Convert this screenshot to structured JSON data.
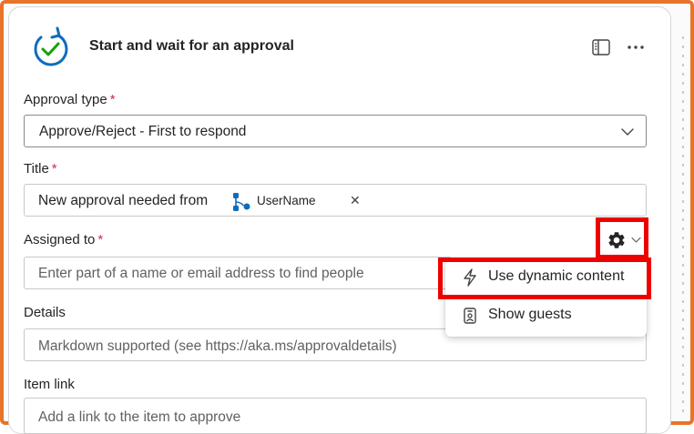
{
  "action": {
    "title": "Start and wait for an approval",
    "icon": "approval-refresh-check-icon"
  },
  "header_actions": [
    {
      "name": "panel",
      "icon": "side-panel-icon"
    },
    {
      "name": "more",
      "icon": "more-horizontal-icon"
    }
  ],
  "fields": {
    "approval_type": {
      "label": "Approval type",
      "required_marker": "*",
      "value": "Approve/Reject - First to respond"
    },
    "title": {
      "label": "Title",
      "required_marker": "*",
      "value_prefix": "New approval needed from",
      "token_label": "UserName",
      "token_remove": "✕"
    },
    "assigned_to": {
      "label": "Assigned to",
      "required_marker": "*",
      "placeholder": "Enter part of a name or email address to find people"
    },
    "details": {
      "label": "Details",
      "placeholder": "Markdown supported (see https://aka.ms/approvaldetails)"
    },
    "item_link": {
      "label": "Item link",
      "placeholder": "Add a link to the item to approve"
    }
  },
  "settings_menu": {
    "items": [
      {
        "label": "Use dynamic content",
        "icon": "lightning-icon"
      },
      {
        "label": "Show guests",
        "icon": "guest-badge-icon"
      }
    ]
  },
  "colors": {
    "frame_border": "#e8742a",
    "highlight": "#ee0000",
    "required": "#c4314b",
    "accent": "#0f6cbd"
  }
}
